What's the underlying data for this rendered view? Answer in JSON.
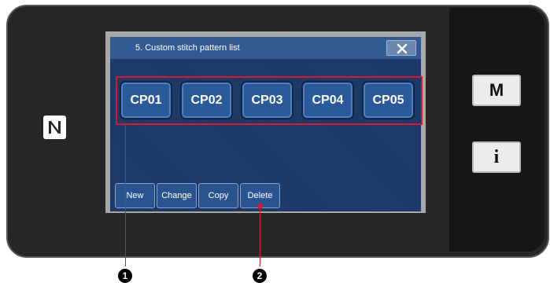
{
  "dialog": {
    "title": "5.   Custom stitch pattern list"
  },
  "patterns": [
    "CP01",
    "CP02",
    "CP03",
    "CP04",
    "CP05"
  ],
  "actions": {
    "new_label": "New",
    "change_label": "Change",
    "copy_label": "Copy",
    "delete_label": "Delete"
  },
  "side": {
    "m_label": "M",
    "info_label": "i"
  },
  "callouts": [
    "1",
    "2"
  ],
  "icons": {
    "nfc": "nfc-icon",
    "close": "close-icon"
  },
  "colors": {
    "dialog_bg": "#1b3766",
    "titlebar": "#2f5791",
    "button": "#2a5a9a",
    "highlight": "#d31a30"
  }
}
